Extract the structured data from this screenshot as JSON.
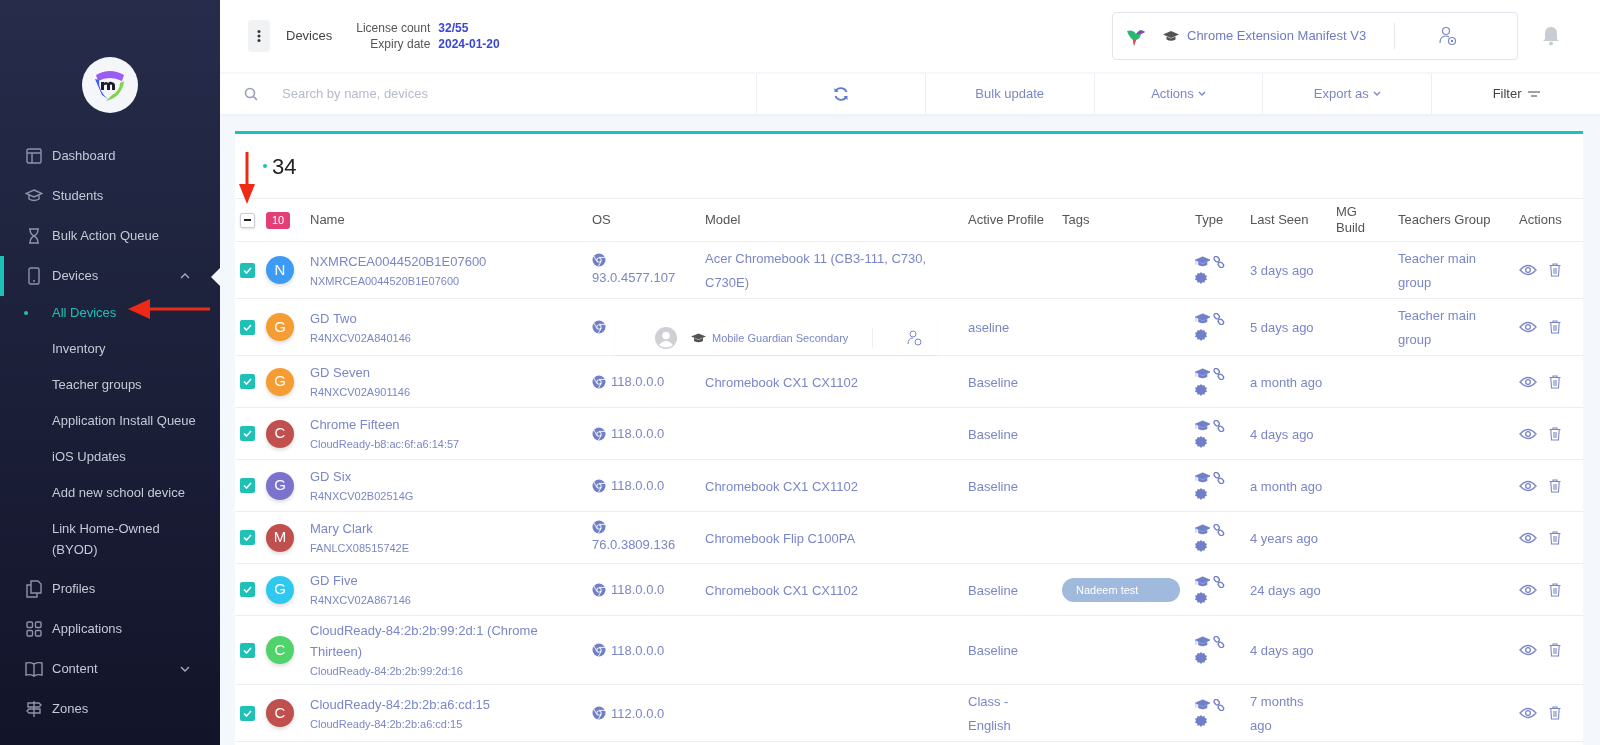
{
  "sidebar": {
    "items": [
      {
        "label": "Dashboard",
        "selected": false
      },
      {
        "label": "Students",
        "selected": false
      },
      {
        "label": "Bulk Action Queue",
        "selected": false
      },
      {
        "label": "Devices",
        "selected": true,
        "expanded": true,
        "children": [
          {
            "label": "All Devices",
            "selected": true
          },
          {
            "label": "Inventory",
            "selected": false
          },
          {
            "label": "Teacher groups",
            "selected": false
          },
          {
            "label": "Application Install Queue",
            "selected": false
          },
          {
            "label": "iOS Updates",
            "selected": false
          },
          {
            "label": "Add new school device",
            "selected": false
          },
          {
            "label": "Link Home-Owned (BYOD)",
            "selected": false
          }
        ]
      },
      {
        "label": "Profiles",
        "selected": false
      },
      {
        "label": "Applications",
        "selected": false
      },
      {
        "label": "Content",
        "selected": false,
        "expanded": false
      },
      {
        "label": "Zones",
        "selected": false
      }
    ]
  },
  "header": {
    "title": "Devices",
    "license_count_label": "License count",
    "license_count": "32/55",
    "expiry_label": "Expiry date",
    "expiry_date": "2024-01-20",
    "profile": "Chrome Extension Manifest V3"
  },
  "toolbar": {
    "search_placeholder": "Search by name, devices",
    "buttons": [
      {
        "kind": "refresh"
      },
      {
        "kind": "plain",
        "label": "Bulk update"
      },
      {
        "kind": "dropdown",
        "label": "Actions"
      },
      {
        "kind": "dropdown",
        "label": "Export as"
      },
      {
        "kind": "filter",
        "label": "Filter"
      }
    ]
  },
  "table": {
    "count": "34",
    "select_all_partial": true,
    "selected_count": "10",
    "columns": [
      "Name",
      "OS",
      "Model",
      "Active Profile",
      "Tags",
      "Type",
      "Last Seen",
      "MG Build",
      "Teachers Group",
      "Actions"
    ],
    "rows": [
      {
        "checked": true,
        "initial": "N",
        "color": "#3d9bf5",
        "name": "NXMRCEA0044520B1E07600",
        "serial": "NXMRCEA0044520B1E07600",
        "os": "93.0.4577.107",
        "model": "Acer Chromebook 11 (CB3-111, C730, C730E)",
        "last_seen": "3 days ago",
        "teachers_group": "Teacher main group"
      },
      {
        "checked": true,
        "initial": "G",
        "color": "#f59d32",
        "name": "GD Two",
        "serial": "R4NXCV02A840146",
        "active_profile": "aseline",
        "last_seen": "5 days ago",
        "teachers_group": "Teacher main group"
      },
      {
        "checked": true,
        "initial": "G",
        "color": "#f59d32",
        "name": "GD Seven",
        "serial": "R4NXCV02A901146",
        "os": "118.0.0.0",
        "model": "Chromebook CX1 CX1102",
        "active_profile": "Baseline",
        "last_seen": "a month ago"
      },
      {
        "checked": true,
        "initial": "C",
        "color": "#c0504d",
        "name": "Chrome Fifteen",
        "serial": "CloudReady-b8:ac:6f:a6:14:57",
        "os": "118.0.0.0",
        "active_profile": "Baseline",
        "last_seen": "4 days ago"
      },
      {
        "checked": true,
        "initial": "G",
        "color": "#7a72cc",
        "name": "GD Six",
        "serial": "R4NXCV02B02514G",
        "os": "118.0.0.0",
        "model": "Chromebook CX1 CX1102",
        "active_profile": "Baseline",
        "last_seen": "a month ago"
      },
      {
        "checked": true,
        "initial": "M",
        "color": "#c0504d",
        "name": "Mary Clark",
        "serial": "FANLCX08515742E",
        "os": "76.0.3809.136",
        "model": "Chromebook Flip C100PA",
        "last_seen": "4 years ago"
      },
      {
        "checked": true,
        "initial": "G",
        "color": "#2fc9ef",
        "name": "GD Five",
        "serial": "R4NXCV02A867146",
        "os": "118.0.0.0",
        "model": "Chromebook CX1 CX1102",
        "active_profile": "Baseline",
        "tag": "Nadeem test",
        "last_seen": "24 days ago"
      },
      {
        "checked": true,
        "initial": "C",
        "color": "#4fd36a",
        "name": "CloudReady-84:2b:2b:99:2d:1 (Chrome Thirteen)",
        "serial": "CloudReady-84:2b:2b:99:2d:16",
        "os": "118.0.0.0",
        "active_profile": "Baseline",
        "last_seen": "4 days ago"
      },
      {
        "checked": true,
        "initial": "C",
        "color": "#c0504d",
        "name": "CloudReady-84:2b:2b:a6:cd:15",
        "serial": "CloudReady-84:2b:2b:a6:cd:15",
        "os": "112.0.0.0",
        "active_profile": "Class - English",
        "last_seen": "7 months ago"
      }
    ]
  },
  "popup": {
    "label": "Mobile Guardian Secondary"
  }
}
